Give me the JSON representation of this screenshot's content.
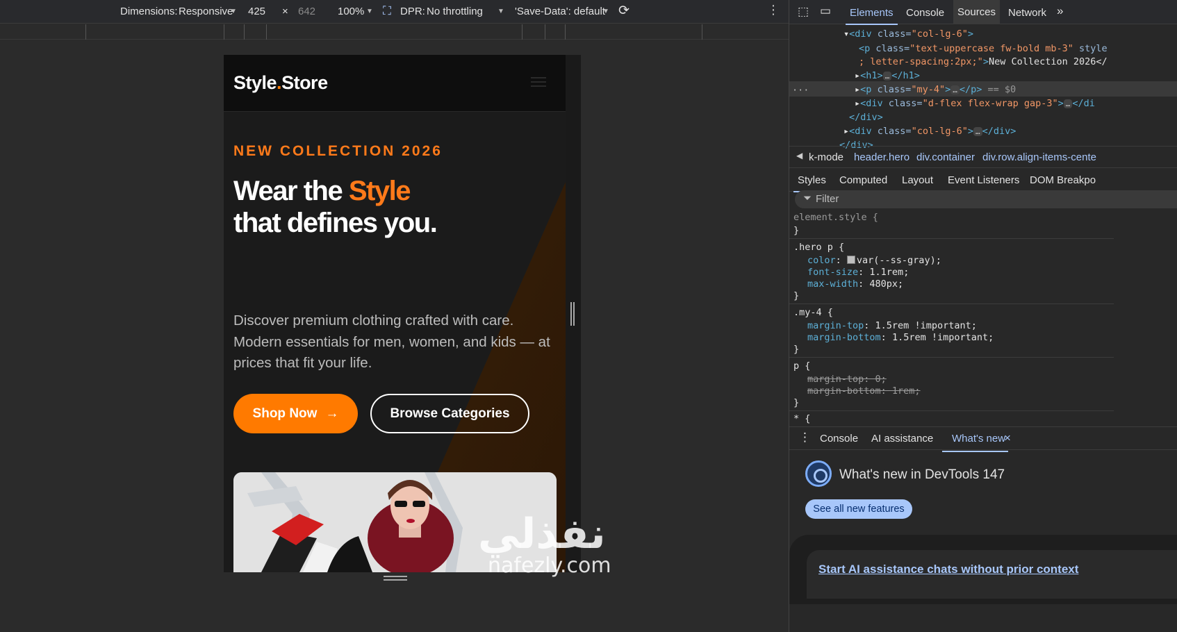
{
  "emulation": {
    "dimensions_label": "Dimensions:",
    "dimensions_mode": "Responsive",
    "width": "425",
    "times": "×",
    "height": "642",
    "zoom": "100%",
    "dpr_label": "DPR:",
    "throttling": "No throttling",
    "save_data": "'Save-Data': default"
  },
  "site": {
    "brand_name": "Style",
    "brand_dot": ".",
    "brand_suffix": "Store",
    "eyebrow": "NEW COLLECTION 2026",
    "headline_pre": "Wear the ",
    "headline_accent": "Style",
    "headline_post": "that defines you.",
    "lead": "Discover premium clothing crafted with care. Modern essentials for men, women, and kids — at prices that fit your life.",
    "cta_primary": "Shop Now",
    "cta_primary_arrow": "→",
    "cta_secondary": "Browse Categories",
    "accent_color": "#ff7a00"
  },
  "watermark": {
    "arabic": "نفذلي",
    "latin": "nafezly.com"
  },
  "devtools": {
    "tabs": [
      "Elements",
      "Console",
      "Sources",
      "Network",
      "»"
    ],
    "active_tab": "Elements",
    "dom_lines": {
      "l1_open": "<div",
      "l1_attr": "class=",
      "l1_val": "\"col-lg-6\"",
      "l1_close": ">",
      "l2_open": "<p",
      "l2_attr": "class=",
      "l2_val": "\"text-uppercase fw-bold mb-3\"",
      "l2_attr2": "style",
      "l3_val": "; letter-spacing:2px;\"",
      "l3_close": ">",
      "l3_text": "New Collection 2026</",
      "l4": "<h1>",
      "l4_close": "</h1>",
      "l5_open": "<p",
      "l5_attr": "class=",
      "l5_val": "\"my-4\"",
      "l5_close": "</p>",
      "l5_ref": "== $0",
      "l6_open": "<div",
      "l6_attr": "class=",
      "l6_val": "\"d-flex flex-wrap gap-3\"",
      "l6_close": "</di",
      "l7": "</div>",
      "l8_open": "<div",
      "l8_attr": "class=",
      "l8_val": "\"col-lg-6\"",
      "l8_close": "</div>",
      "l9": "</div>",
      "ellipsis": "…",
      "row_dots": "···"
    },
    "breadcrumbs": [
      "k-mode",
      "header.hero",
      "div.container",
      "div.row.align-items-cente"
    ],
    "sub_tabs": [
      "Styles",
      "Computed",
      "Layout",
      "Event Listeners",
      "DOM Breakpo"
    ],
    "filter_placeholder": "Filter",
    "rules": {
      "element_style": "element.style {",
      "close": "}",
      "hero_sel": ".hero p {",
      "hero_color_prop": "color",
      "hero_color_val": "var(--ss-gray);",
      "hero_fs_prop": "font-size",
      "hero_fs_val": "1.1rem;",
      "hero_mw_prop": "max-width",
      "hero_mw_val": "480px;",
      "my4_sel": ".my-4 {",
      "my4_mt_prop": "margin-top",
      "my4_mt_val": "1.5rem !important;",
      "my4_mb_prop": "margin-bottom",
      "my4_mb_val": "1.5rem !important;",
      "p_sel": "p {",
      "p_mt": "margin-top: 0;",
      "p_mb": "margin-bottom: 1rem;",
      "star_sel": "* {"
    },
    "drawer_tabs": [
      "Console",
      "AI assistance",
      "What's new"
    ],
    "drawer_close": "×",
    "whats_new_title": "What's new in DevTools 147",
    "whats_new_button": "See all new features",
    "whats_new_link": "Start AI assistance chats without prior context"
  }
}
